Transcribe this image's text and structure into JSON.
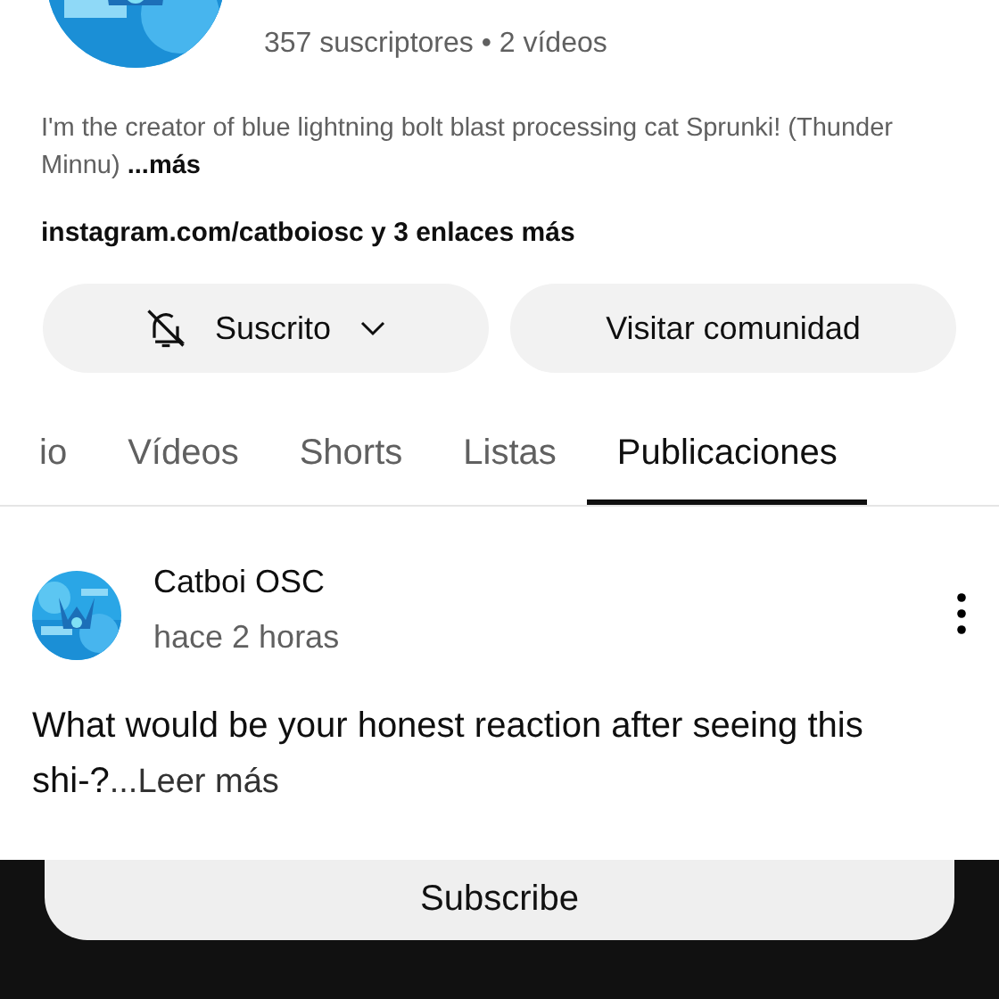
{
  "channel": {
    "stats": "357 suscriptores • 2 vídeos",
    "description": "I'm the creator of blue lightning bolt blast processing cat Sprunki! (Thunder Minnu)",
    "more": "...más",
    "links": "instagram.com/catboiosc y 3 enlaces más"
  },
  "buttons": [
    {
      "kind": "subscribed",
      "label": "Suscrito"
    },
    {
      "kind": "plain",
      "label": "Visitar comunidad"
    }
  ],
  "tabs": [
    {
      "label": "io",
      "selected": false
    },
    {
      "label": "Vídeos",
      "selected": false
    },
    {
      "label": "Shorts",
      "selected": false
    },
    {
      "label": "Listas",
      "selected": false
    },
    {
      "label": "Publicaciones",
      "selected": true
    }
  ],
  "post": {
    "author": "Catboi OSC",
    "time": "hace 2 horas",
    "text": "What would be your honest reaction after seeing this shi-?",
    "more": "...Leer más"
  },
  "overlay": {
    "button": "Subscribe"
  }
}
